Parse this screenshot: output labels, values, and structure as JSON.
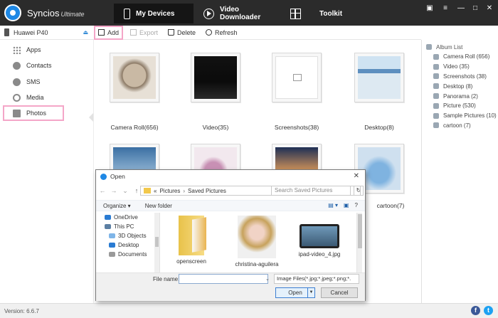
{
  "app": {
    "name": "Syncios",
    "edition": "Ultimate"
  },
  "nav": {
    "tabs": [
      {
        "label": "My Devices"
      },
      {
        "label": "Video Downloader"
      },
      {
        "label": "Toolkit"
      }
    ]
  },
  "window_controls": {
    "chat": "▣",
    "menu": "≡",
    "minimize": "—",
    "maximize": "□",
    "close": "✕"
  },
  "device": {
    "name": "Huawei P40"
  },
  "toolbar": {
    "add": "Add",
    "export": "Export",
    "delete": "Delete",
    "refresh": "Refresh"
  },
  "sidebar": {
    "items": [
      {
        "label": "Apps",
        "icon": "apps-icon"
      },
      {
        "label": "Contacts",
        "icon": "contacts-icon"
      },
      {
        "label": "SMS",
        "icon": "sms-icon"
      },
      {
        "label": "Media",
        "icon": "media-icon"
      },
      {
        "label": "Photos",
        "icon": "photos-icon"
      }
    ]
  },
  "albums": [
    {
      "label": "Camera Roll(656)"
    },
    {
      "label": "Video(35)"
    },
    {
      "label": "Screenshots(38)"
    },
    {
      "label": "Desktop(8)"
    },
    {
      "label": ""
    },
    {
      "label": ""
    },
    {
      "label": ""
    },
    {
      "label": "cartoon(7)"
    }
  ],
  "album_list": {
    "title": "Album List",
    "items": [
      {
        "label": "Camera Roll (656)"
      },
      {
        "label": "Video (35)"
      },
      {
        "label": "Screenshots (38)"
      },
      {
        "label": "Desktop (8)"
      },
      {
        "label": "Panorama (2)"
      },
      {
        "label": "Picture (530)"
      },
      {
        "label": "Sample Pictures (10)"
      },
      {
        "label": "cartoon (7)"
      }
    ]
  },
  "status": {
    "version": "Version: 6.6.7",
    "facebook": "f",
    "twitter": "t"
  },
  "dialog": {
    "title": "Open",
    "close": "✕",
    "address": {
      "prefix": "«",
      "part1": "Pictures",
      "sep": "›",
      "part2": "Saved Pictures"
    },
    "refresh": "↻",
    "search_placeholder": "Search Saved Pictures",
    "organize": "Organize ▾",
    "new_folder": "New folder",
    "tree": [
      {
        "label": "OneDrive"
      },
      {
        "label": "This PC"
      },
      {
        "label": "3D Objects"
      },
      {
        "label": "Desktop"
      },
      {
        "label": "Documents"
      }
    ],
    "files": [
      {
        "label": "openscreen"
      },
      {
        "label": "christina-aguilera"
      },
      {
        "label": "ipad-video_4.jpg"
      }
    ],
    "file_name_label": "File name:",
    "file_name_value": "",
    "filter": "Image Files(*.jpg;*.jpeg;*.png;*.",
    "open": "Open",
    "cancel": "Cancel"
  },
  "colors": {
    "header": "#2b2b2b",
    "accent": "#1e88e5",
    "highlight": "#f4a6c8"
  }
}
